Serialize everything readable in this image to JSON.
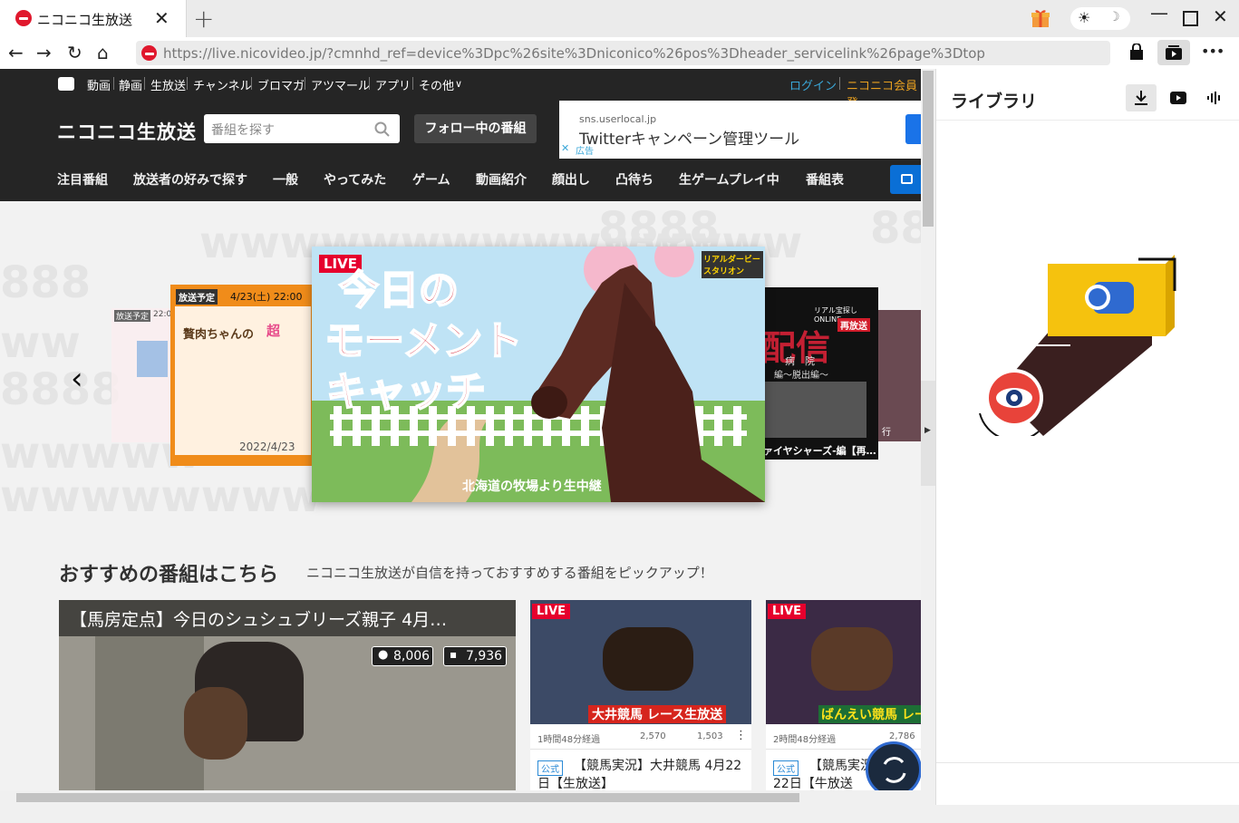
{
  "tab": {
    "title": "ニコニコ生放送",
    "close": "✕",
    "new": "+"
  },
  "window": {
    "minimize": "—",
    "maximize": "☐",
    "close": "✕",
    "theme_light": "☀",
    "theme_dark": "☽"
  },
  "address": {
    "url": "https://live.nicovideo.jp/?cmnhd_ref=device%3Dpc%26site%3Dniconico%26pos%3Dheader_servicelink%26page%3Dtop",
    "more": "•••"
  },
  "nico": {
    "topnav": [
      "動画",
      "静画",
      "生放送",
      "チャンネル",
      "ブロマガ",
      "アツマール",
      "アプリ",
      "その他"
    ],
    "login": "ログイン",
    "register": "ニコニコ会員登",
    "logo": "ニコニコ生放送",
    "search_placeholder": "番組を探す",
    "follow_button": "フォロー中の番組",
    "ad": {
      "domain": "sns.userlocal.jp",
      "text": "Twitterキャンペーン管理ツール",
      "label": "広告"
    },
    "categories": [
      "注目番組",
      "放送者の好みで探す",
      "一般",
      "やってみた",
      "ゲーム",
      "動画紹介",
      "顔出し",
      "凸待ち",
      "生ゲームプレイ中",
      "番組表"
    ]
  },
  "carousel": {
    "prev": "‹",
    "center": {
      "badge": "LIVE",
      "title1": "今日の",
      "title2": "モーメント",
      "title3": "キャッチ",
      "caption": "北海道の牧場より生中継",
      "corner": "リアルダービースタリオン"
    },
    "left": {
      "badge": "放送予定",
      "date": "4/23(土) 22:00",
      "title": "贅肉ちゃんの",
      "sub": "2022/4/23",
      "tag": "超"
    },
    "far_left": {
      "badge": "放送予定",
      "time": "22:0"
    },
    "right": {
      "badge": "再放送",
      "top": "リアル宝探しONLINE",
      "big": "配信",
      "caption": "ァイヤシャーズ-編【再…",
      "sub1": "病　院",
      "sub2": "編～脱出編～"
    },
    "far_right": {
      "caption": "行"
    }
  },
  "recommend": {
    "heading": "おすすめの番組はこちら",
    "subheading": "ニコニコ生放送が自信を持っておすすめする番組をピックアップ！",
    "big": {
      "title": "【馬房定点】今日のシュシュブリーズ親子 4月…",
      "viewers": "8,006",
      "comments": "7,936"
    },
    "cards": [
      {
        "badge": "LIVE",
        "banner": "大井競馬 レース生放送",
        "elapsed": "1時間48分経過",
        "viewers": "2,570",
        "comments": "1,503",
        "official": "公式",
        "title": "【競馬実況】大井競馬 4月22日【生放送】"
      },
      {
        "badge": "LIVE",
        "banner": "ばんえい競馬 レー",
        "elapsed": "2時間48分経過",
        "viewers": "2,786",
        "official": "公式",
        "title": "【競馬実況】 4月22日【牛放送"
      }
    ]
  },
  "sidebar": {
    "title": "ライブラリ"
  }
}
